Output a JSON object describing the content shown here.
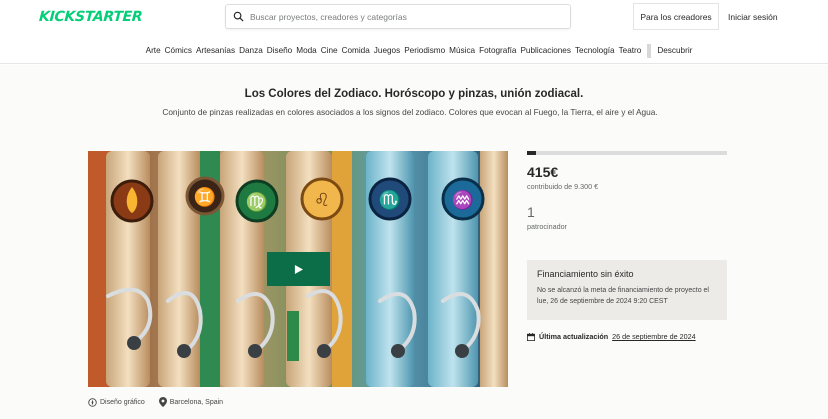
{
  "header": {
    "logo": "KICKSTARTER",
    "search_placeholder": "Buscar proyectos, creadores y categorías",
    "creators_button": "Para los creadores",
    "login_link": "Iniciar sesión"
  },
  "categories": [
    "Arte",
    "Cómics",
    "Artesanías",
    "Danza",
    "Diseño",
    "Moda",
    "Cine",
    "Comida",
    "Juegos",
    "Periodismo",
    "Música",
    "Fotografía",
    "Publicaciones",
    "Tecnología",
    "Teatro"
  ],
  "discover": "Descubrir",
  "project": {
    "title": "Los Colores del Zodiaco. Horóscopo y pinzas, unión zodiacal.",
    "blurb": "Conjunto de pinzas realizadas en colores asociados a los signos del zodiaco. Colores que evocan al Fuego, la Tierra, el aire y el Agua.",
    "pledged": "415€",
    "goal": "contribuido de 9.300 €",
    "funded_fraction": 0.045,
    "backers": "1",
    "backers_label": "patrocinador",
    "status_title": "Financiamiento sin éxito",
    "status_desc": "No se alcanzó la meta de financiamiento de proyecto el lue, 26 de septiembre de 2024 9:20 CEST",
    "last_updated_label": "Última actualización",
    "last_updated_date": "26 de septiembre de 2024",
    "category": "Diseño gráfico",
    "location": "Barcelona, Spain"
  },
  "colors": {
    "brand": "#05ce78",
    "play_button": "#0b6e48",
    "status_bg": "#ecebe8"
  }
}
